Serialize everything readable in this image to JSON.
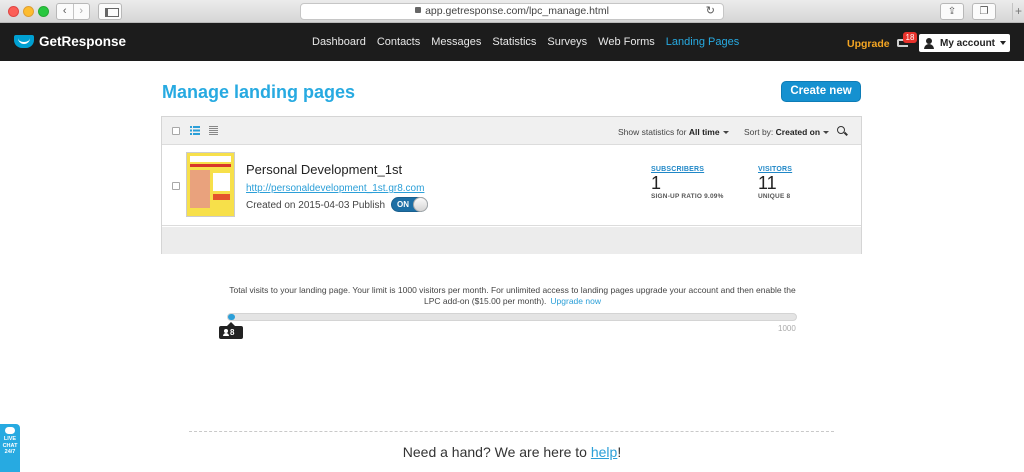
{
  "browser": {
    "url": "app.getresponse.com/lpc_manage.html",
    "back_glyph": "‹",
    "forward_glyph": "›",
    "reload_glyph": "↻",
    "share_glyph": "⇪",
    "tabs_glyph": "❐",
    "plus_glyph": "+"
  },
  "header": {
    "brand": "GetResponse",
    "nav": [
      "Dashboard",
      "Contacts",
      "Messages",
      "Statistics",
      "Surveys",
      "Web Forms",
      "Landing Pages"
    ],
    "active_nav": "Landing Pages",
    "upgrade": "Upgrade",
    "notification_count": "18",
    "account": "My account"
  },
  "page": {
    "title": "Manage landing pages",
    "create_button": "Create new"
  },
  "toolbar": {
    "stats_label": "Show statistics for",
    "stats_value": "All time",
    "sort_label": "Sort by:",
    "sort_value": "Created on"
  },
  "landing_pages": [
    {
      "name": "Personal Development_1st",
      "url": "http://personaldevelopment_1st.gr8.com",
      "created": "Created on 2015-04-03",
      "publish_label": "Publish",
      "toggle": "ON",
      "subscribers_label": "SUBSCRIBERS",
      "subscribers": "1",
      "signup_ratio": "SIGN-UP RATIO 9.09%",
      "visitors_label": "VISITORS",
      "visitors": "11",
      "unique": "UNIQUE 8"
    }
  ],
  "limits": {
    "note": "Total visits to your landing page. Your limit is 1000 visitors per month. For unlimited access to landing pages upgrade your account and then enable the LPC add-on ($15.00 per month).",
    "upgrade_link": "Upgrade now",
    "current": "8",
    "max": "1000",
    "fill_fraction": 0.008
  },
  "help": {
    "prefix": "Need a hand? We are here to ",
    "link": "help",
    "suffix": "!"
  },
  "livechat": {
    "line1": "LIVE",
    "line2": "CHAT",
    "line3": "24/7"
  },
  "colors": {
    "accent": "#27aae1",
    "header_bg": "#1c1c1c",
    "upgrade": "#f5a623",
    "badge": "#e8322c"
  }
}
